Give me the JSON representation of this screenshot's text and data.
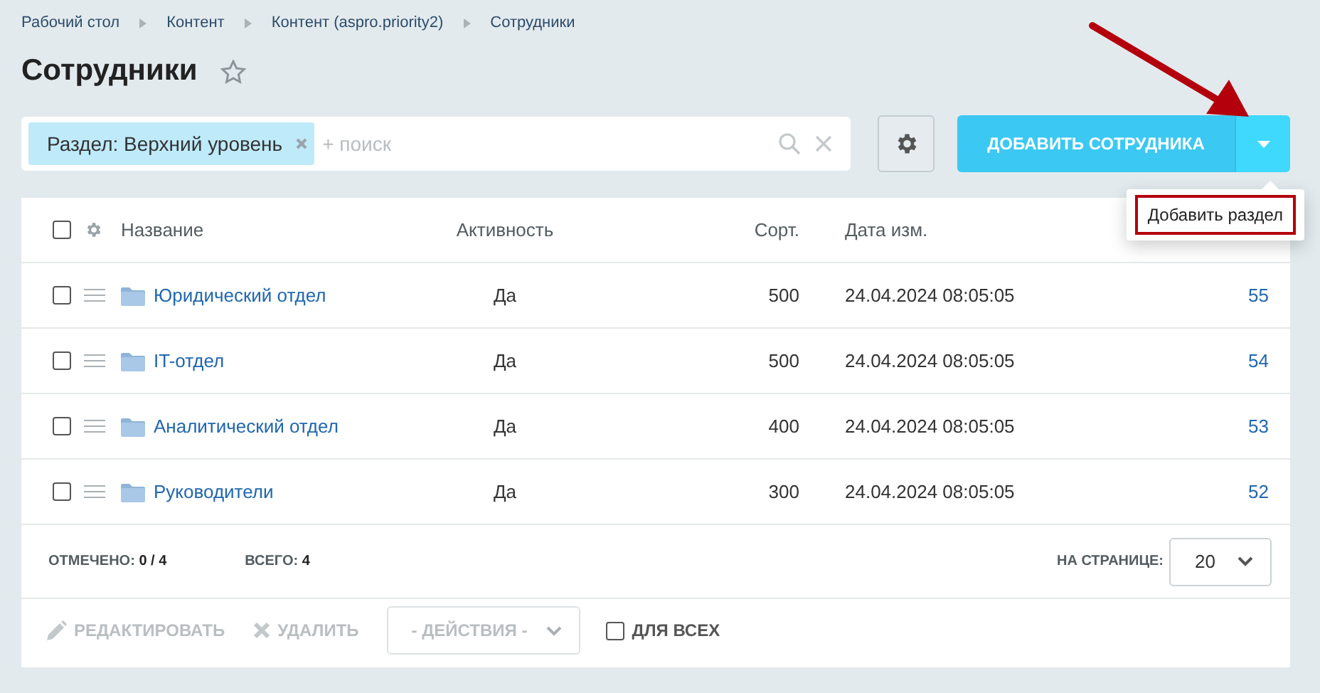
{
  "breadcrumbs": [
    "Рабочий стол",
    "Контент",
    "Контент (aspro.priority2)",
    "Сотрудники"
  ],
  "title": "Сотрудники",
  "favorite": false,
  "filter": {
    "tag": "Раздел: Верхний уровень",
    "placeholder": "+ поиск"
  },
  "add_button": {
    "label": "ДОБАВИТЬ СОТРУДНИКА",
    "menu_open": true,
    "menu_items": [
      {
        "label": "Добавить раздел",
        "highlighted": true
      }
    ]
  },
  "table": {
    "select_all_checked": false,
    "columns": [
      "Название",
      "Активность",
      "Сорт.",
      "Дата изм."
    ],
    "rows": [
      {
        "checked": false,
        "name": "Юридический отдел",
        "active": "Да",
        "sort": "500",
        "date": "24.04.2024 08:05:05",
        "column_5": "55"
      },
      {
        "checked": false,
        "name": "IT-отдел",
        "active": "Да",
        "sort": "500",
        "date": "24.04.2024 08:05:05",
        "column_5": "54"
      },
      {
        "checked": false,
        "name": "Аналитический отдел",
        "active": "Да",
        "sort": "400",
        "date": "24.04.2024 08:05:05",
        "column_5": "53"
      },
      {
        "checked": false,
        "name": "Руководители",
        "active": "Да",
        "sort": "300",
        "date": "24.04.2024 08:05:05",
        "column_5": "52"
      }
    ]
  },
  "footer": {
    "selected_label": "ОТМЕЧЕНО:",
    "selected_value": "0 / 4",
    "total_label": "ВСЕГО:",
    "total_value": "4",
    "per_page_label": "НА СТРАНИЦЕ:",
    "per_page": "20"
  },
  "actions": {
    "edit": "РЕДАКТИРОВАТЬ",
    "delete": "УДАЛИТЬ",
    "actions_select": "- ДЕЙСТВИЯ -",
    "for_all": {
      "label": "ДЛЯ ВСЕХ",
      "checked": false
    },
    "disabled": true
  }
}
